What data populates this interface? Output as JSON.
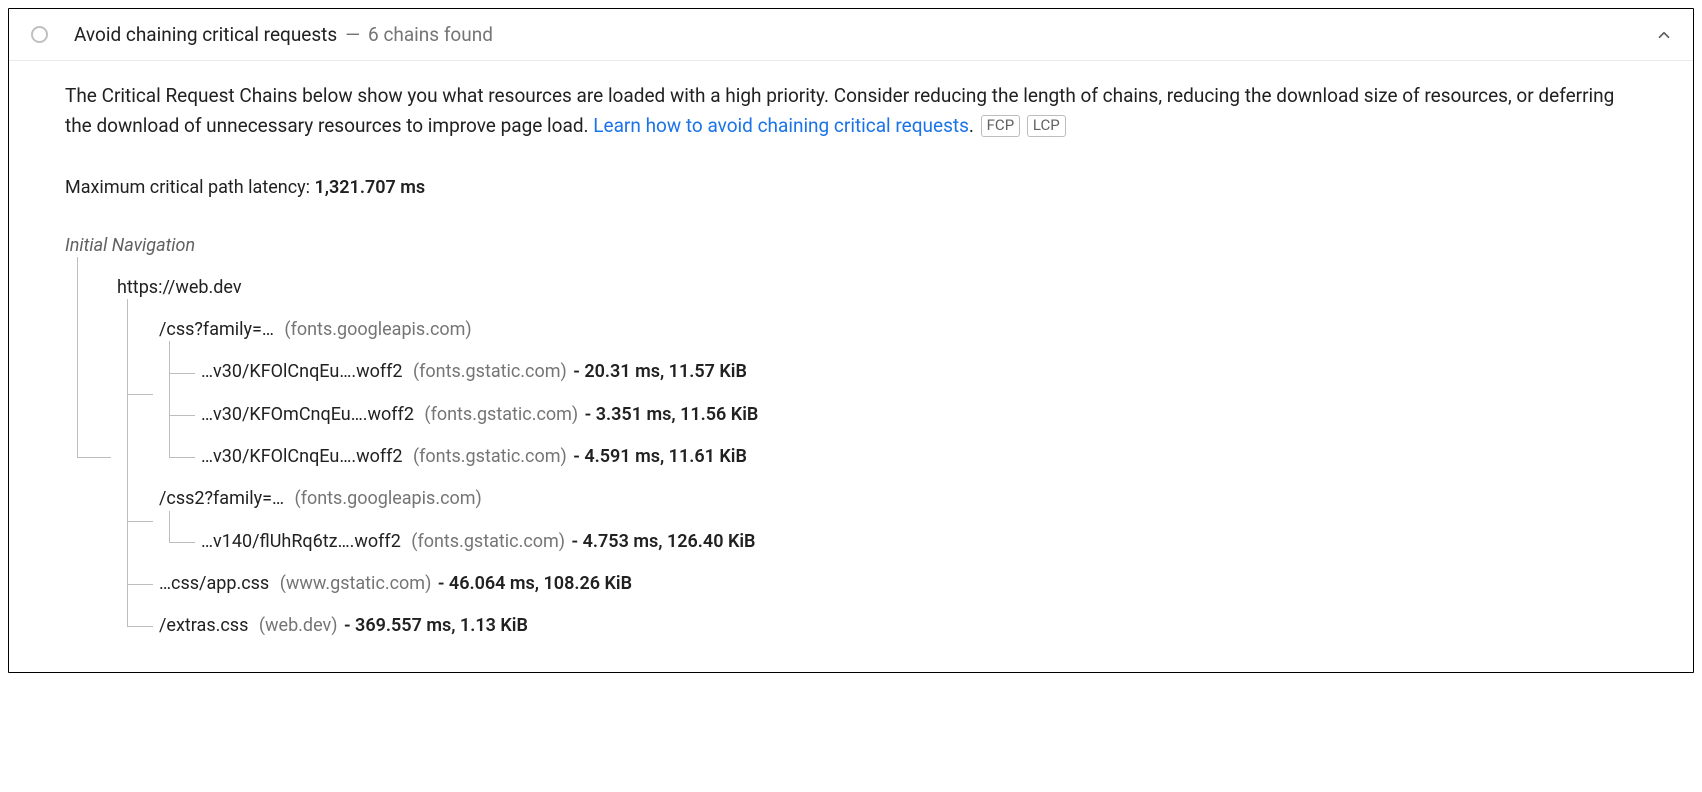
{
  "header": {
    "title": "Avoid chaining critical requests",
    "sep": "—",
    "sub": "6 chains found"
  },
  "description": {
    "text_a": "The Critical Request Chains below show you what resources are loaded with a high priority. Consider reducing the length of chains, reducing the download size of resources, or deferring the download of unnecessary resources to improve page load. ",
    "link_text": "Learn how to avoid chaining critical requests",
    "text_b": ".",
    "chips": [
      "FCP",
      "LCP"
    ]
  },
  "latency": {
    "label": "Maximum critical path latency: ",
    "value": "1,321.707 ms"
  },
  "tree": {
    "root_label": "Initial Navigation",
    "nodes": [
      {
        "path": "https://web.dev",
        "origin": "",
        "stats": "",
        "children": [
          {
            "path": "/css?family=…",
            "origin": "(fonts.googleapis.com)",
            "stats": "",
            "children": [
              {
                "path": "…v30/KFOlCnqEu….woff2",
                "origin": "(fonts.gstatic.com)",
                "stats": "- 20.31 ms, 11.57 KiB"
              },
              {
                "path": "…v30/KFOmCnqEu….woff2",
                "origin": "(fonts.gstatic.com)",
                "stats": "- 3.351 ms, 11.56 KiB"
              },
              {
                "path": "…v30/KFOlCnqEu….woff2",
                "origin": "(fonts.gstatic.com)",
                "stats": "- 4.591 ms, 11.61 KiB"
              }
            ]
          },
          {
            "path": "/css2?family=…",
            "origin": "(fonts.googleapis.com)",
            "stats": "",
            "children": [
              {
                "path": "…v140/flUhRq6tz….woff2",
                "origin": "(fonts.gstatic.com)",
                "stats": "- 4.753 ms, 126.40 KiB"
              }
            ]
          },
          {
            "path": "…css/app.css",
            "origin": "(www.gstatic.com)",
            "stats": "- 46.064 ms, 108.26 KiB"
          },
          {
            "path": "/extras.css",
            "origin": "(web.dev)",
            "stats": "- 369.557 ms, 1.13 KiB"
          }
        ]
      }
    ]
  }
}
